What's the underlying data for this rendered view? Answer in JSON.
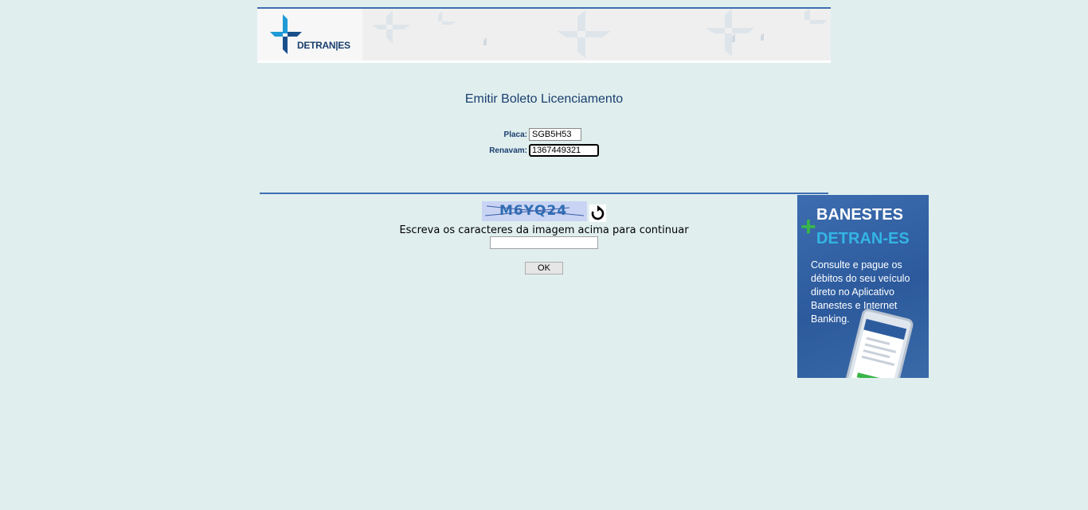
{
  "header": {
    "logo_text": "DETRAN|ES"
  },
  "form": {
    "title": "Emitir Boleto Licenciamento",
    "placa_label": "Placa:",
    "placa_value": "SGB5H53",
    "renavam_label": "Renavam:",
    "renavam_value": "1367449321"
  },
  "captcha": {
    "image_text": "M6YQ24",
    "hint": "Escreva os caracteres da imagem acima para continuar",
    "input_value": "",
    "submit_label": "OK"
  },
  "ad": {
    "brand": "BANESTES",
    "subbrand": "DETRAN-ES",
    "plus_symbol": "+",
    "body": "Consulte e pague os débitos do seu veículo direto no Aplicativo Banestes e Internet Banking."
  },
  "colors": {
    "page_bg": "#e0eeee",
    "accent_blue": "#3e6fb0",
    "title_text": "#1a3f6e",
    "ad_green": "#39b54a"
  }
}
